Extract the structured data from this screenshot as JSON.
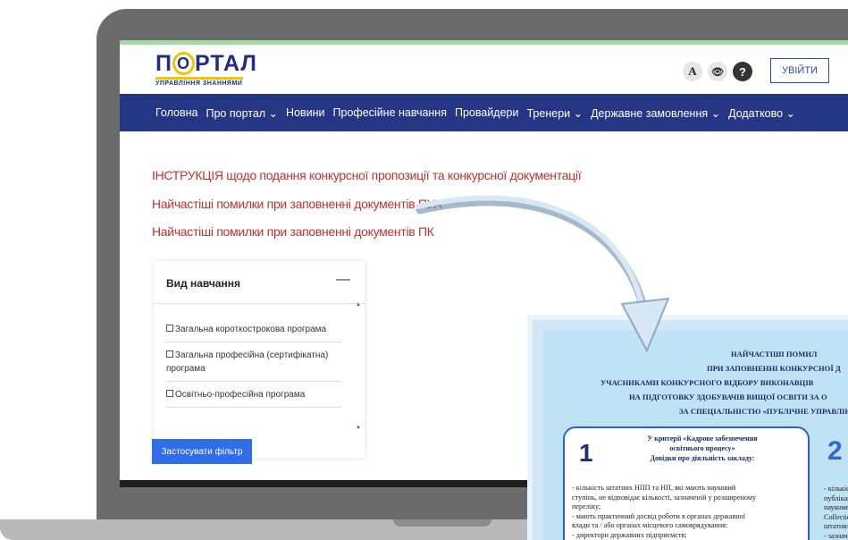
{
  "logo": {
    "main_pre": "П",
    "main_o": "О",
    "main_post": "РТАЛ",
    "sub": "УПРАВЛІННЯ ЗНАННЯМИ"
  },
  "header": {
    "font_size_icon": "A",
    "visibility_icon": "👁",
    "help_icon": "?",
    "login_label": "УВІЙТИ"
  },
  "nav": [
    {
      "label": "Головна"
    },
    {
      "label": "Про портал ⌄"
    },
    {
      "label": "Новини"
    },
    {
      "label": "Професійне навчання"
    },
    {
      "label": "Провайдери"
    },
    {
      "label": "Тренери ⌄"
    },
    {
      "label": "Державне замовлення ⌄"
    },
    {
      "label": "Додатково ⌄"
    }
  ],
  "links": [
    "ІНСТРУКЦІЯ щодо подання конкурсної пропозиції та конкурсної документації",
    "Найчастіші помилки при заповненні документів ПУА",
    "Найчастіші помилки при заповненні документів ПК"
  ],
  "filter": {
    "title": "Вид навчання",
    "collapse": "—",
    "options": [
      "Загальна короткострокова програма",
      "Загальна професійна (сертифікатна) програма",
      "Освітньо-професійна програма"
    ],
    "apply_label": "Застосувати фільтр"
  },
  "overlay": {
    "heading": [
      "НАЙЧАСТІШІ ПОМИЛ",
      "ПРИ ЗАПОВНЕННІ КОНКУРСНОЇ Д",
      "УЧАСНИКАМИ КОНКУРСНОГО ВІДБОРУ ВИКОНАВЦІВ",
      "НА ПІДГОТОВКУ ЗДОБУВАЧІВ ВИЩОЇ ОСВІТИ ЗА О",
      "ЗА СПЕЦІАЛЬНІСТЮ «ПУБЛІЧНЕ УПРАВЛІНН"
    ],
    "box1": {
      "number": "1",
      "title": [
        "У критерії «Кадрове забезпечення",
        "освітнього процесу»",
        "Довідки про діяльність закладу:"
      ],
      "text": [
        "- кількість штатних НПП та НП, які мають науковий",
        "ступінь, не відповідає кількості, зазначеній у розширеному",
        "переліку;",
        "- мають практичний досвід роботи в органах державної",
        "влади та / або органах місцевого самоврядування:",
        "- директори державних підприємств;"
      ]
    },
    "box2": {
      "number": "2",
      "text": [
        "- кількість",
        "публікаці",
        "наукомет",
        "Collectio",
        "штатних",
        "- зазнач"
      ]
    }
  }
}
